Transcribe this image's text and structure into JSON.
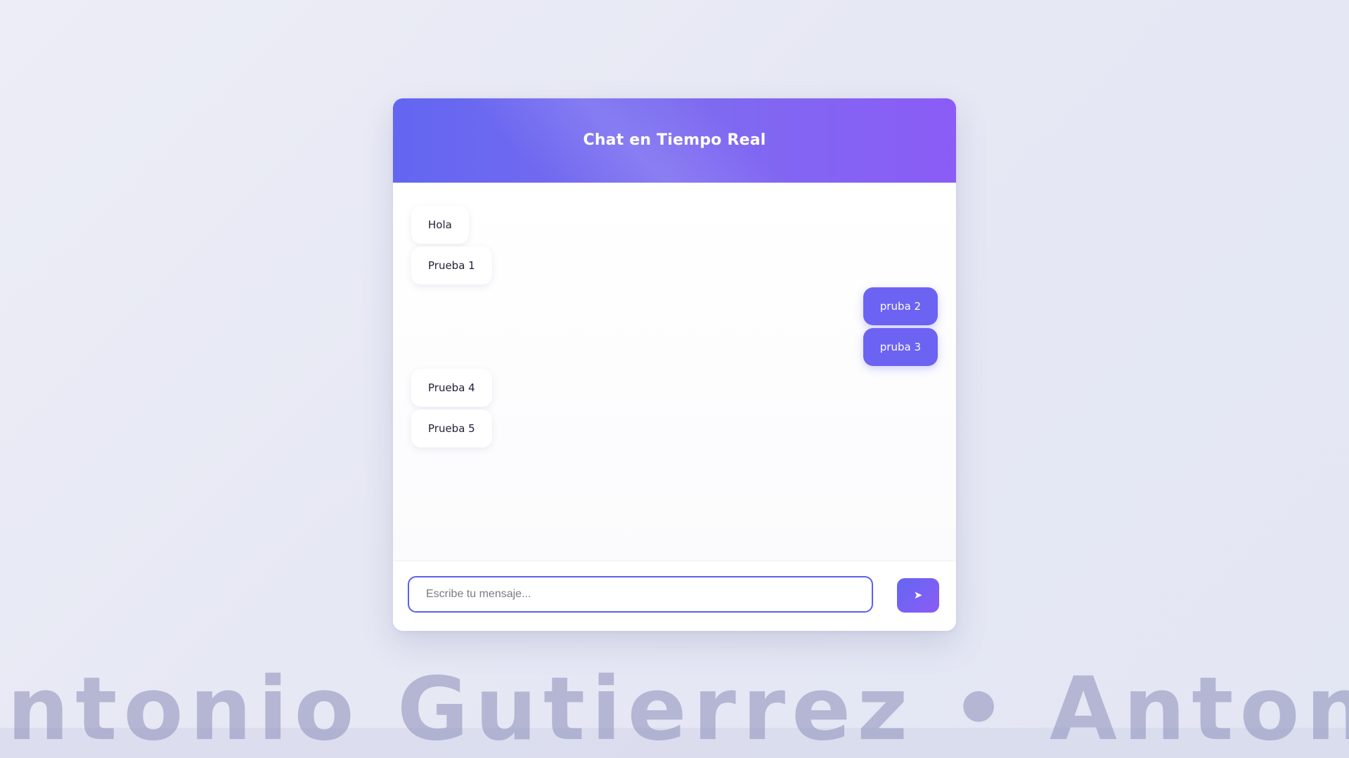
{
  "chat": {
    "title": "Chat en Tiempo Real",
    "messages": [
      {
        "text": "Hola",
        "direction": "received"
      },
      {
        "text": "Prueba 1",
        "direction": "received"
      },
      {
        "text": "pruba 2",
        "direction": "sent"
      },
      {
        "text": "pruba 3",
        "direction": "sent"
      },
      {
        "text": "Prueba 4",
        "direction": "received"
      },
      {
        "text": "Prueba 5",
        "direction": "received"
      }
    ],
    "input": {
      "value": "",
      "placeholder": "Escribe tu mensaje..."
    },
    "send_icon": "➤"
  },
  "watermark": {
    "text": "Antonio Gutierrez • Antonio Gutierrez • Antonio Gu"
  },
  "colors": {
    "accent_start": "#6366f1",
    "accent_end": "#8b5cf6",
    "sent_bubble": "#6c63f2",
    "received_bubble": "#ffffff"
  }
}
